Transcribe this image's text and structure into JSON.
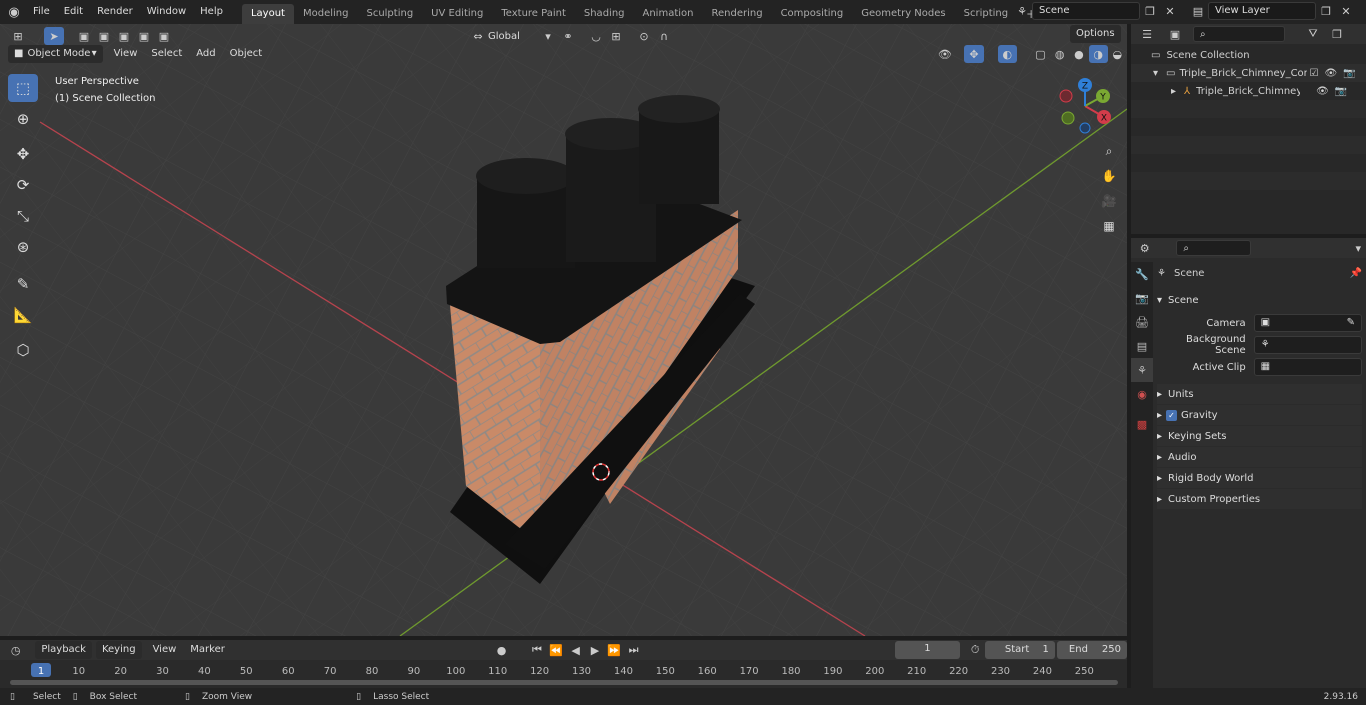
{
  "menu": [
    "File",
    "Edit",
    "Render",
    "Window",
    "Help"
  ],
  "workspaces": [
    "Layout",
    "Modeling",
    "Sculpting",
    "UV Editing",
    "Texture Paint",
    "Shading",
    "Animation",
    "Rendering",
    "Compositing",
    "Geometry Nodes",
    "Scripting"
  ],
  "scene_name": "Scene",
  "view_layer": "View Layer",
  "viewport": {
    "mode": "Object Mode",
    "menus": [
      "View",
      "Select",
      "Add",
      "Object"
    ],
    "transform_orientation": "Global",
    "options_label": "Options",
    "overlay_title": "User Perspective",
    "overlay_subtitle": "(1) Scene Collection",
    "gizmo": {
      "x": "X",
      "y": "Y",
      "z": "Z"
    }
  },
  "outliner": {
    "root": "Scene Collection",
    "items": [
      {
        "label": "Triple_Brick_Chimney_Corner"
      },
      {
        "label": "Triple_Brick_Chimney_Cc"
      }
    ]
  },
  "properties": {
    "header": "Scene",
    "panel": "Scene",
    "fields": [
      {
        "label": "Camera"
      },
      {
        "label": "Background Scene"
      },
      {
        "label": "Active Clip"
      }
    ],
    "sections": [
      "Units",
      "Gravity",
      "Keying Sets",
      "Audio",
      "Rigid Body World",
      "Custom Properties"
    ]
  },
  "timeline": {
    "menus": [
      "Playback",
      "Keying",
      "View",
      "Marker"
    ],
    "current_frame": "1",
    "start_label": "Start",
    "start": "1",
    "end_label": "End",
    "end": "250",
    "ticks": [
      "1",
      "10",
      "20",
      "30",
      "40",
      "50",
      "60",
      "70",
      "80",
      "90",
      "100",
      "110",
      "120",
      "130",
      "140",
      "150",
      "160",
      "170",
      "180",
      "190",
      "200",
      "210",
      "220",
      "230",
      "240",
      "250"
    ]
  },
  "status": {
    "select": "Select",
    "box_select": "Box Select",
    "zoom_view": "Zoom View",
    "lasso_select": "Lasso Select",
    "version": "2.93.16"
  },
  "colors": {
    "accent": "#4772b3",
    "x_axis": "#d33c4a",
    "y_axis": "#7aa832",
    "z_axis": "#2f7fd8",
    "brick": "#c98a68"
  }
}
